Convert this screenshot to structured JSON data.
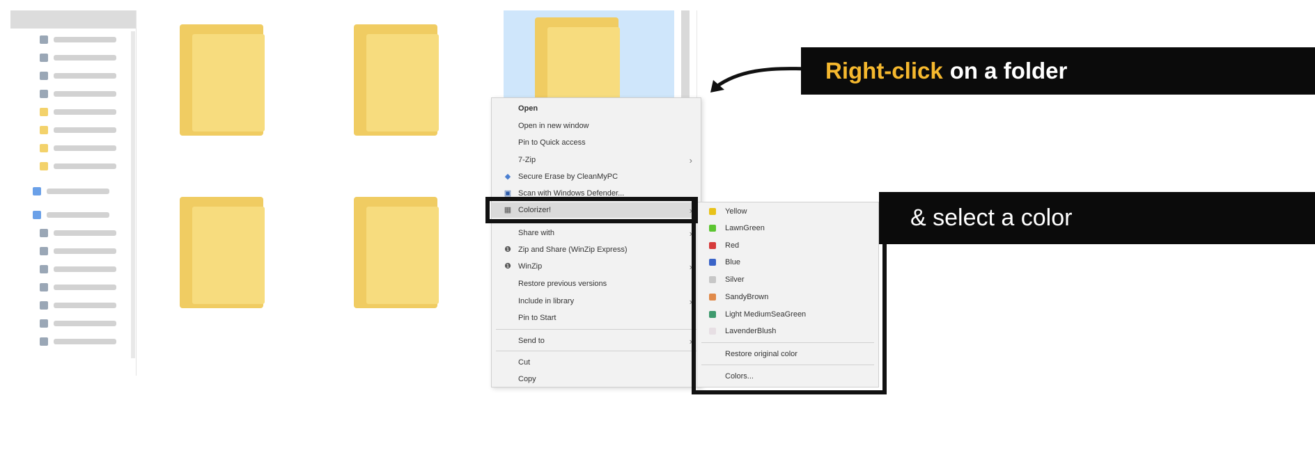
{
  "callouts": {
    "first_highlight": "Right-click",
    "first_rest": "on a folder",
    "second": "& select a color"
  },
  "context_menu": {
    "items": [
      {
        "label": "Open",
        "icon": "",
        "bold": true
      },
      {
        "label": "Open in new window",
        "icon": ""
      },
      {
        "label": "Pin to Quick access",
        "icon": ""
      },
      {
        "label": "7-Zip",
        "icon": "",
        "submenu": true
      },
      {
        "label": "Secure Erase by CleanMyPC",
        "icon": "shield-icon"
      },
      {
        "label": "Scan with Windows Defender...",
        "icon": "defender-icon"
      },
      {
        "label": "Colorizer!",
        "icon": "colorizer-icon",
        "submenu": true,
        "highlighted": true
      },
      {
        "label": "Share with",
        "icon": "",
        "submenu": true
      },
      {
        "label": "Zip and Share (WinZip Express)",
        "icon": "winzip-icon"
      },
      {
        "label": "WinZip",
        "icon": "winzip-icon",
        "submenu": true
      },
      {
        "label": "Restore previous versions",
        "icon": ""
      },
      {
        "label": "Include in library",
        "icon": "",
        "submenu": true
      },
      {
        "label": "Pin to Start",
        "icon": ""
      },
      {
        "label": "Send to",
        "icon": "",
        "submenu": true
      },
      {
        "label": "Cut",
        "icon": ""
      },
      {
        "label": "Copy",
        "icon": ""
      }
    ]
  },
  "colorizer_submenu": {
    "items": [
      {
        "label": "Yellow",
        "color": "#e8c21a"
      },
      {
        "label": "LawnGreen",
        "color": "#5cc531"
      },
      {
        "label": "Red",
        "color": "#d63a3a"
      },
      {
        "label": "Blue",
        "color": "#3a64c8"
      },
      {
        "label": "Silver",
        "color": "#c7c7c7"
      },
      {
        "label": "SandyBrown",
        "color": "#e08a4a"
      },
      {
        "label": "Light MediumSeaGreen",
        "color": "#3e9a6e"
      },
      {
        "label": "LavenderBlush",
        "color": "#e7dfe4"
      },
      {
        "label": "Restore original color",
        "color": ""
      },
      {
        "label": "Colors...",
        "color": ""
      }
    ]
  },
  "colors": {
    "callout_bg": "#0b0b0b",
    "callout_accent": "#f5b82e",
    "folder": "#f7dc7e",
    "selection": "#cfe6fb"
  }
}
